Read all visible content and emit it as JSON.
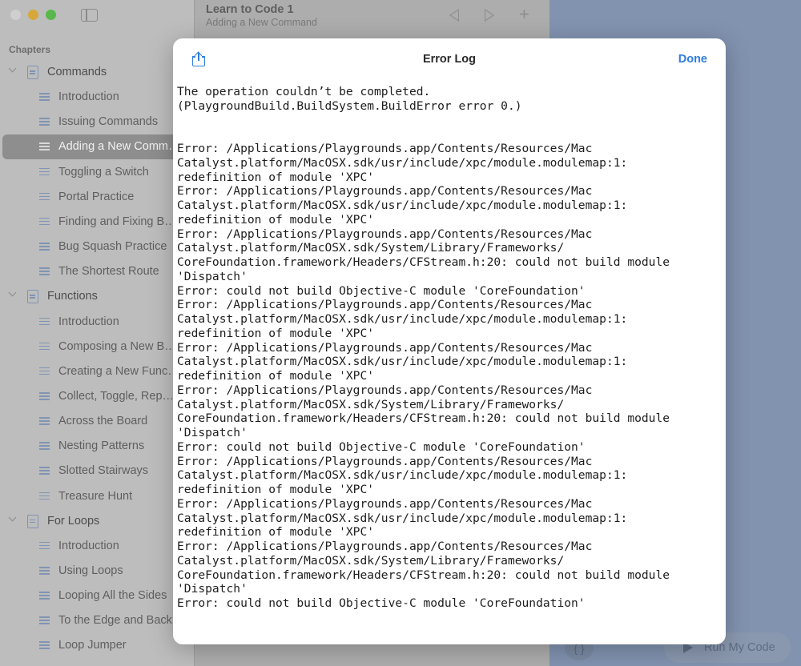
{
  "window": {
    "title": "Learn to Code 1",
    "subtitle": "Adding a New Command"
  },
  "sidebar": {
    "heading": "Chapters",
    "rows": [
      {
        "type": "chapter",
        "label": "Commands"
      },
      {
        "type": "page",
        "label": "Introduction"
      },
      {
        "type": "page",
        "label": "Issuing Commands"
      },
      {
        "type": "page",
        "label": "Adding a New Comm…",
        "selected": true
      },
      {
        "type": "page",
        "label": "Toggling a Switch"
      },
      {
        "type": "page",
        "label": "Portal Practice"
      },
      {
        "type": "page",
        "label": "Finding and Fixing B…"
      },
      {
        "type": "page",
        "label": "Bug Squash Practice"
      },
      {
        "type": "page",
        "label": "The Shortest Route"
      },
      {
        "type": "chapter",
        "label": "Functions"
      },
      {
        "type": "page",
        "label": "Introduction"
      },
      {
        "type": "page",
        "label": "Composing a New B…"
      },
      {
        "type": "page",
        "label": "Creating a New Func…"
      },
      {
        "type": "page",
        "label": "Collect, Toggle, Rep…"
      },
      {
        "type": "page",
        "label": "Across the Board"
      },
      {
        "type": "page",
        "label": "Nesting Patterns"
      },
      {
        "type": "page",
        "label": "Slotted Stairways"
      },
      {
        "type": "page",
        "label": "Treasure Hunt"
      },
      {
        "type": "chapter",
        "label": "For Loops"
      },
      {
        "type": "page",
        "label": "Introduction"
      },
      {
        "type": "page",
        "label": "Using Loops"
      },
      {
        "type": "page",
        "label": "Looping All the Sides"
      },
      {
        "type": "page",
        "label": "To the Edge and Back"
      },
      {
        "type": "page",
        "label": "Loop Jumper"
      }
    ]
  },
  "editor": {
    "braces_label": "{ }",
    "run_label": "Run My Code"
  },
  "modal": {
    "title": "Error Log",
    "done_label": "Done",
    "log": "The operation couldn’t be completed.\n(PlaygroundBuild.BuildSystem.BuildError error 0.)\n\n\nError: /Applications/Playgrounds.app/Contents/Resources/Mac\nCatalyst.platform/MacOSX.sdk/usr/include/xpc/module.modulemap:1:\nredefinition of module 'XPC'\nError: /Applications/Playgrounds.app/Contents/Resources/Mac\nCatalyst.platform/MacOSX.sdk/usr/include/xpc/module.modulemap:1:\nredefinition of module 'XPC'\nError: /Applications/Playgrounds.app/Contents/Resources/Mac\nCatalyst.platform/MacOSX.sdk/System/Library/Frameworks/\nCoreFoundation.framework/Headers/CFStream.h:20: could not build module\n'Dispatch'\nError: could not build Objective-C module 'CoreFoundation'\nError: /Applications/Playgrounds.app/Contents/Resources/Mac\nCatalyst.platform/MacOSX.sdk/usr/include/xpc/module.modulemap:1:\nredefinition of module 'XPC'\nError: /Applications/Playgrounds.app/Contents/Resources/Mac\nCatalyst.platform/MacOSX.sdk/usr/include/xpc/module.modulemap:1:\nredefinition of module 'XPC'\nError: /Applications/Playgrounds.app/Contents/Resources/Mac\nCatalyst.platform/MacOSX.sdk/System/Library/Frameworks/\nCoreFoundation.framework/Headers/CFStream.h:20: could not build module\n'Dispatch'\nError: could not build Objective-C module 'CoreFoundation'\nError: /Applications/Playgrounds.app/Contents/Resources/Mac\nCatalyst.platform/MacOSX.sdk/usr/include/xpc/module.modulemap:1:\nredefinition of module 'XPC'\nError: /Applications/Playgrounds.app/Contents/Resources/Mac\nCatalyst.platform/MacOSX.sdk/usr/include/xpc/module.modulemap:1:\nredefinition of module 'XPC'\nError: /Applications/Playgrounds.app/Contents/Resources/Mac\nCatalyst.platform/MacOSX.sdk/System/Library/Frameworks/\nCoreFoundation.framework/Headers/CFStream.h:20: could not build module\n'Dispatch'\nError: could not build Objective-C module 'CoreFoundation'"
  },
  "colors": {
    "accent": "#2f7de1",
    "sidebar_bg": "#bdbdbd",
    "selected_row": "#8e8e8e",
    "right_panel": "#8293b0"
  },
  "icons": {
    "window_controls": [
      "close-icon",
      "minimize-icon",
      "maximize-icon"
    ],
    "toolbar": [
      "sidebar-toggle-icon",
      "back-icon",
      "forward-icon",
      "add-icon"
    ],
    "chapter": "book-icon",
    "page": "page-lines-icon",
    "modal": "share-icon"
  }
}
